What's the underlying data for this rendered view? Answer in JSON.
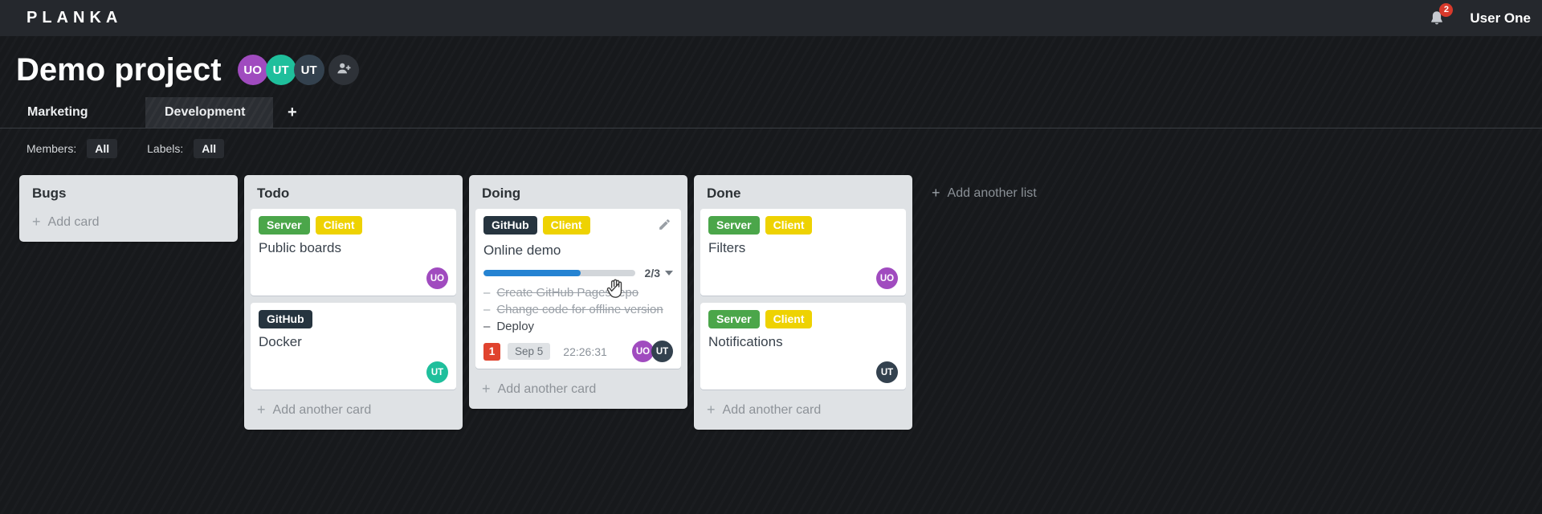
{
  "topbar": {
    "logo": "PLANKA",
    "notifications_count": "2",
    "user_name": "User One"
  },
  "project": {
    "title": "Demo project",
    "members": [
      {
        "initials": "UO",
        "color": "#a04bbf"
      },
      {
        "initials": "UT",
        "color": "#1fbf9c"
      },
      {
        "initials": "UT",
        "color": "#33414e"
      }
    ]
  },
  "tabs": {
    "items": [
      {
        "label": "Marketing",
        "active": false
      },
      {
        "label": "Development",
        "active": true
      }
    ],
    "add_label": "+"
  },
  "filters": {
    "members_label": "Members:",
    "members_value": "All",
    "labels_label": "Labels:",
    "labels_value": "All"
  },
  "board": {
    "add_list_label": "Add another list",
    "lists": [
      {
        "title": "Bugs",
        "add_label": "Add card",
        "cards": []
      },
      {
        "title": "Todo",
        "add_label": "Add another card",
        "cards": [
          {
            "title": "Public boards",
            "labels": [
              {
                "text": "Server",
                "color": "#4ba64a"
              },
              {
                "text": "Client",
                "color": "#eed202"
              }
            ],
            "members": [
              {
                "initials": "UO",
                "color": "#a04bbf"
              }
            ]
          },
          {
            "title": "Docker",
            "labels": [
              {
                "text": "GitHub",
                "color": "#26343f"
              }
            ],
            "members": [
              {
                "initials": "UT",
                "color": "#1fbf9c"
              }
            ]
          }
        ]
      },
      {
        "title": "Doing",
        "add_label": "Add another card",
        "cards": [
          {
            "title": "Online demo",
            "labels": [
              {
                "text": "GitHub",
                "color": "#26343f"
              },
              {
                "text": "Client",
                "color": "#eed202"
              }
            ],
            "progress": {
              "label": "2/3",
              "percent": "64%",
              "done": 2,
              "total": 3
            },
            "tasks": [
              {
                "text": "Create GitHub Pages repo",
                "done": true
              },
              {
                "text": "Change code for offline version",
                "done": true
              },
              {
                "text": "Deploy",
                "done": false
              }
            ],
            "notifications_count": "1",
            "due_date": "Sep 5",
            "timer": "22:26:31",
            "members": [
              {
                "initials": "UO",
                "color": "#a04bbf"
              },
              {
                "initials": "UT",
                "color": "#33414e"
              }
            ]
          }
        ]
      },
      {
        "title": "Done",
        "add_label": "Add another card",
        "cards": [
          {
            "title": "Filters",
            "labels": [
              {
                "text": "Server",
                "color": "#4ba64a"
              },
              {
                "text": "Client",
                "color": "#eed202"
              }
            ],
            "members": [
              {
                "initials": "UO",
                "color": "#a04bbf"
              }
            ]
          },
          {
            "title": "Notifications",
            "labels": [
              {
                "text": "Server",
                "color": "#4ba64a"
              },
              {
                "text": "Client",
                "color": "#eed202"
              }
            ],
            "members": [
              {
                "initials": "UT",
                "color": "#33414e"
              }
            ]
          }
        ]
      }
    ]
  },
  "task_dash": "–"
}
